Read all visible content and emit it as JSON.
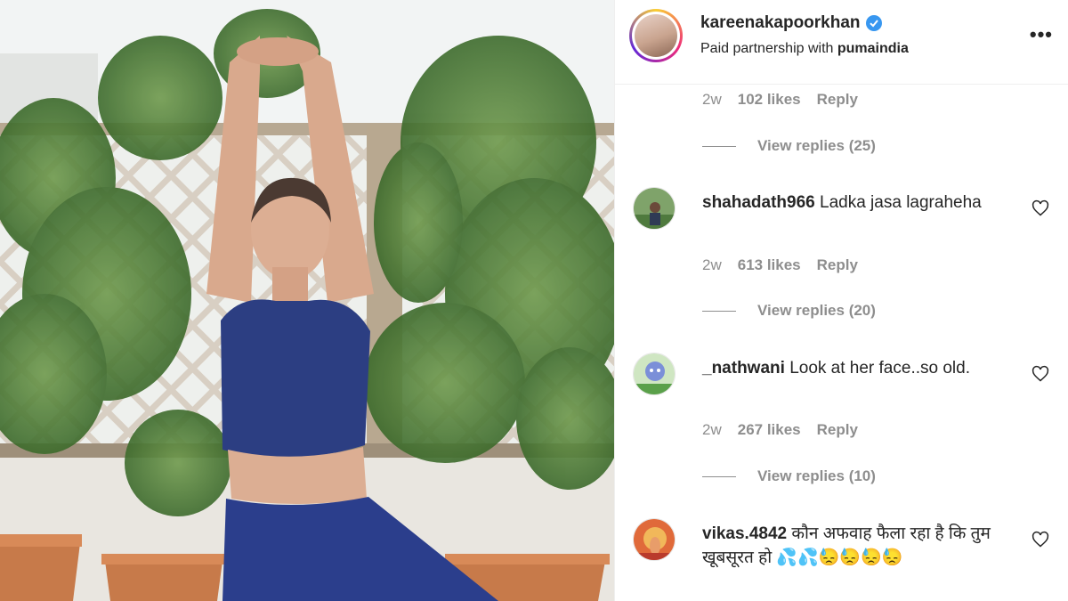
{
  "post": {
    "username": "kareenakapoorkhan",
    "partnership_prefix": "Paid partnership with",
    "partner": "pumaindia",
    "more_label": "•••",
    "verified_icon": "verified-badge-icon",
    "colors": {
      "verified": "#3897f0",
      "meta": "#8e8e8e",
      "text": "#262626"
    }
  },
  "top_meta": {
    "time": "2w",
    "likes": "102 likes",
    "reply": "Reply"
  },
  "top_view_replies": "View replies (25)",
  "comments": [
    {
      "username": "shahadath966",
      "text": "Ladka jasa lagraheha",
      "time": "2w",
      "likes": "613 likes",
      "reply": "Reply",
      "view_replies": "View replies (20)",
      "like_icon": "heart-outline-icon"
    },
    {
      "username": "_nathwani",
      "text": "Look at her face..so old.",
      "time": "2w",
      "likes": "267 likes",
      "reply": "Reply",
      "view_replies": "View replies (10)",
      "like_icon": "heart-outline-icon"
    },
    {
      "username": "vikas.4842",
      "text": "कौन अफवाह फैला रहा है कि तुम खूबसूरत हो",
      "emojis": "💦💦😓😓😓😓",
      "like_icon": "heart-outline-icon"
    }
  ]
}
